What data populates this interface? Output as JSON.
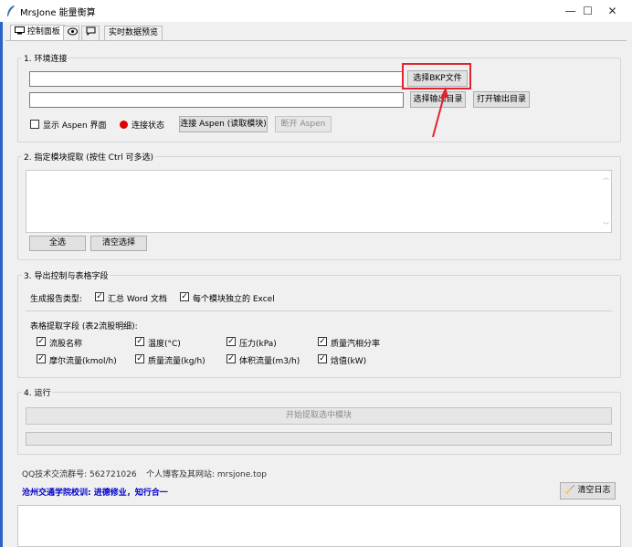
{
  "window": {
    "title": "MrsJone 能量衡算",
    "minimize": "—",
    "maximize": "☐",
    "close": "✕"
  },
  "tabs": [
    {
      "label": "控制面板",
      "icon": "monitor-icon"
    },
    {
      "label": "",
      "icon": "eye-icon"
    },
    {
      "label": "",
      "icon": "comment-icon"
    },
    {
      "label": "实时数据预览"
    }
  ],
  "env": {
    "title": "1. 环境连接",
    "bkp_value": "",
    "out_value": "",
    "select_bkp": "选择BKP文件",
    "select_out": "选择输出目录",
    "open_out": "打开输出目录",
    "show_aspen": "显示 Aspen 界面",
    "status_label": "连接状态",
    "status_color": "#e00000",
    "connect": "连接 Aspen (读取模块)",
    "disconnect": "断开 Aspen"
  },
  "modules": {
    "title": "2. 指定模块提取 (按住 Ctrl 可多选)",
    "select_all": "全选",
    "clear": "清空选择"
  },
  "export": {
    "title": "3. 导出控制与表格字段",
    "report_label": "生成报告类型:",
    "opt_word": "汇总 Word 文档",
    "opt_excel": "每个模块独立的 Excel",
    "fields_label": "表格提取字段 (表2流股明细):",
    "fields": [
      "流股名称",
      "温度(°C)",
      "压力(kPa)",
      "质量汽相分率",
      "摩尔流量(kmol/h)",
      "质量流量(kg/h)",
      "体积流量(m3/h)",
      "焓值(kW)"
    ]
  },
  "run": {
    "title": "4. 运行",
    "start": "开始提取选中模块",
    "progress": 0
  },
  "footer": {
    "qq": "QQ技术交流群号: 562721026",
    "site": "个人博客及其网站: mrsjone.top",
    "motto": "沧州交通学院校训: 进德修业，知行合一",
    "motto_color": "#0000cc",
    "clear_log": "清空日志"
  },
  "annotation": {
    "color": "#e0242f"
  }
}
